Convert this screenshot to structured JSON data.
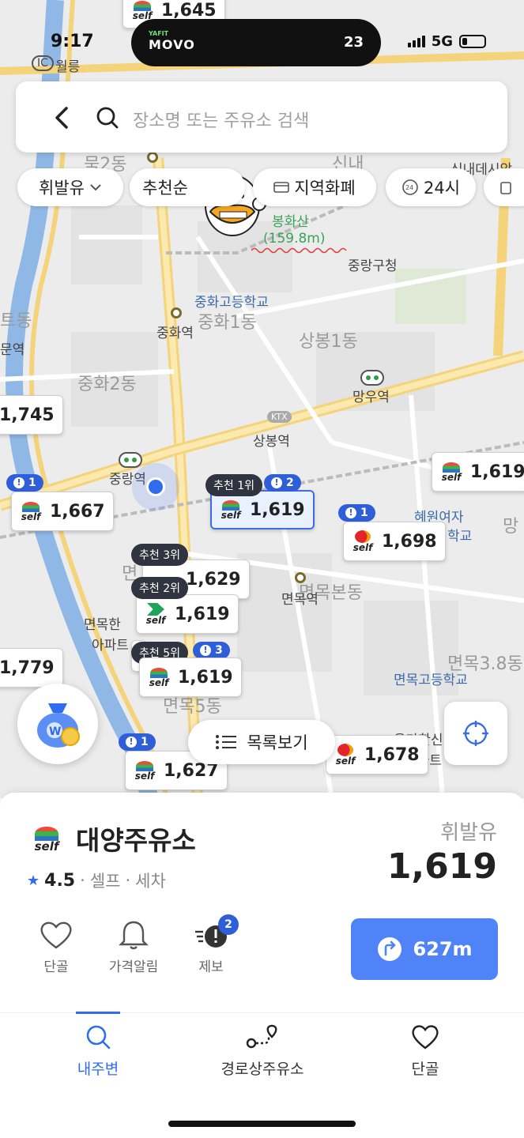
{
  "status_bar": {
    "time": "9:17",
    "island_brand": "MOVO",
    "island_brand_sub": "YAFIT",
    "island_count": "23",
    "network": "5G"
  },
  "search": {
    "placeholder": "장소명 또는 주유소 검색"
  },
  "filters": [
    {
      "label": "휘발유",
      "has_dropdown": true
    },
    {
      "label": "추천순",
      "has_dropdown": true
    },
    {
      "label": "지역화폐",
      "icon": "card-icon"
    },
    {
      "label": "24시",
      "icon": "clock-24-icon"
    }
  ],
  "map": {
    "labels": {
      "ic": "IC",
      "wolleung": "월릉",
      "mok2dong": "묵2동",
      "sinnae": "신내",
      "sinnae_station": "신내데시앙",
      "bonghwasan": "봉화산",
      "distance": "(159.8m)",
      "junggu_office": "중랑구청",
      "junghwa_school": "중화고등학교",
      "junghwa1": "중화1동",
      "junghwa_station": "중화역",
      "sangbong1": "상봉1동",
      "teudong": "트동",
      "munyeok": "문역",
      "junghwa2": "중화2동",
      "mangu_station": "망우역",
      "ktx": "KTX",
      "sangbong_station": "상봉역",
      "jungnang_station": "중랑역",
      "hyewon": "혜원여자",
      "hakgyo": "학교",
      "mang": "망",
      "myeon": "면",
      "myeonmokbon": "면목본동",
      "myeonmok_station": "면목역",
      "myeonmokhan": "면목한",
      "apart": "아파트",
      "myeonmok38": "면목3.8동",
      "myeonmok_school": "면목고등학교",
      "myeonmok5": "면목5동",
      "yongma": "용마한신",
      "apart2": "아파트"
    },
    "pins": [
      {
        "price": "1,645",
        "brand": "self"
      },
      {
        "price": "1,745",
        "brand": "self"
      },
      {
        "price": "1,667",
        "brand": "self",
        "reports": "1"
      },
      {
        "price": "1,619",
        "brand": "self",
        "rank": "추천 1위",
        "reports": "2",
        "selected": true
      },
      {
        "price": "1,619",
        "brand": "self"
      },
      {
        "price": "1,698",
        "brand": "SK",
        "reports": "1"
      },
      {
        "price": "1,629",
        "brand": "self",
        "rank": "추천 3위"
      },
      {
        "price": "1,619",
        "brand": "GS",
        "rank": "추천 2위"
      },
      {
        "price": "1,619",
        "brand": "self",
        "rank": "추천 5위",
        "reports": "3"
      },
      {
        "price": "1,779",
        "brand": "self"
      },
      {
        "price": "1,627",
        "brand": "self",
        "reports": "1"
      },
      {
        "price": "1,678",
        "brand": "SK"
      }
    ],
    "list_button": "목록보기"
  },
  "selected_station": {
    "name": "대양주유소",
    "rating": "4.5",
    "tags": [
      "셀프",
      "세차"
    ],
    "fuel_type": "휘발유",
    "price": "1,619",
    "actions": [
      {
        "label": "단골",
        "icon": "heart-icon"
      },
      {
        "label": "가격알림",
        "icon": "bell-icon"
      },
      {
        "label": "제보",
        "icon": "report-icon",
        "count": "2"
      }
    ],
    "navigate_distance": "627m"
  },
  "tabbar": [
    {
      "label": "내주변",
      "icon": "search-icon",
      "active": true
    },
    {
      "label": "경로상주유소",
      "icon": "route-icon"
    },
    {
      "label": "단골",
      "icon": "heart-icon"
    }
  ],
  "colors": {
    "accent": "#2f6cf0",
    "report_badge": "#2f5fd8",
    "rank_badge": "#2f3440",
    "road_yellow": "#f4d37a",
    "river": "#8fb8e6"
  }
}
